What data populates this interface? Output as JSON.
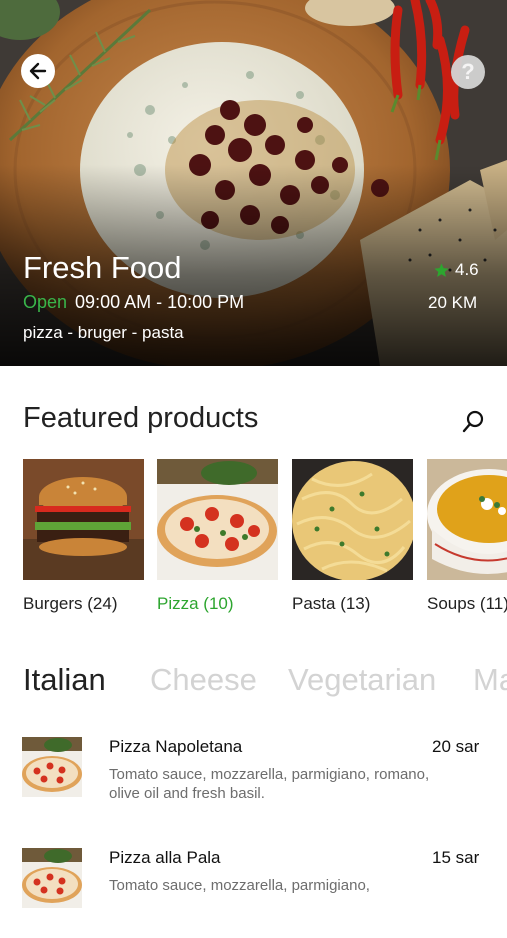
{
  "store": {
    "name": "Fresh Food",
    "status": "Open",
    "hours": "09:00 AM - 10:00 PM",
    "tags": "pizza - bruger - pasta",
    "rating": "4.6",
    "distance": "20 KM"
  },
  "featured": {
    "title": "Featured products",
    "categories": [
      {
        "label": "Burgers (24)"
      },
      {
        "label": "Pizza (10)"
      },
      {
        "label": "Pasta (13)"
      },
      {
        "label": "Soups (11)"
      }
    ]
  },
  "tabs": [
    "Italian",
    "Cheese",
    "Vegetarian",
    "Ma"
  ],
  "menu": [
    {
      "name": "Pizza Napoletana",
      "price": "20 sar",
      "desc": "Tomato sauce, mozzarella, parmigiano, romano, olive oil and fresh basil."
    },
    {
      "name": "Pizza alla Pala",
      "price": "15 sar",
      "desc": "Tomato sauce, mozzarella, parmigiano,"
    }
  ],
  "colors": {
    "open": "#39b54a",
    "active_category": "#2da52f",
    "star": "#2da52f",
    "inactive_tab": "#d3d3d3"
  },
  "icons": [
    "back-arrow-icon",
    "help-icon",
    "star-icon",
    "search-icon"
  ]
}
